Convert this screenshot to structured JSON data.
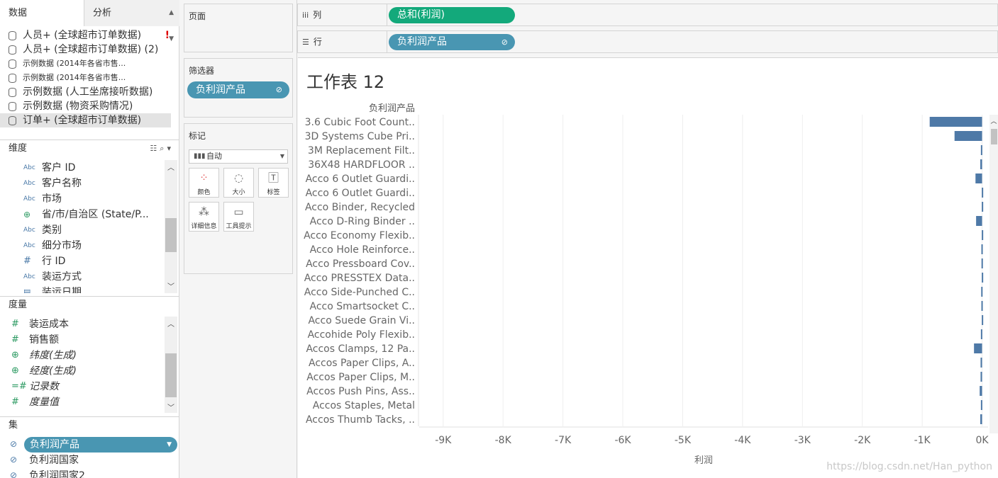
{
  "tabs": {
    "data": "数据",
    "analysis": "分析"
  },
  "datasources": [
    {
      "label": "人员+ (全球超市订单数据)",
      "warn": "!",
      "small": false,
      "selected": false
    },
    {
      "label": "人员+ (全球超市订单数据) (2)",
      "small": false,
      "selected": false
    },
    {
      "label": "示例数据 (2014年各省市售...",
      "small": true,
      "selected": false
    },
    {
      "label": "示例数据 (2014年各省市售...",
      "small": true,
      "selected": false
    },
    {
      "label": "示例数据 (人工坐席接听数据)",
      "small": false,
      "selected": false
    },
    {
      "label": "示例数据 (物资采购情况)",
      "small": false,
      "selected": false
    },
    {
      "label": "订单+ (全球超市订单数据)",
      "small": false,
      "selected": true
    }
  ],
  "dimensions": {
    "header": "维度",
    "items": [
      {
        "icon": "Abc",
        "label": "客户 ID"
      },
      {
        "icon": "Abc",
        "label": "客户名称"
      },
      {
        "icon": "Abc",
        "label": "市场"
      },
      {
        "icon": "globe",
        "label": "省/市/自治区 (State/P..."
      },
      {
        "icon": "Abc",
        "label": "类别"
      },
      {
        "icon": "Abc",
        "label": "细分市场"
      },
      {
        "icon": "#",
        "label": "行 ID"
      },
      {
        "icon": "Abc",
        "label": "装运方式"
      },
      {
        "icon": "date",
        "label": "装运日期"
      }
    ]
  },
  "measures": {
    "header": "度量",
    "items": [
      {
        "icon": "#",
        "label": "装运成本",
        "italic": false
      },
      {
        "icon": "#",
        "label": "销售额",
        "italic": false
      },
      {
        "icon": "globe",
        "label": "纬度(生成)",
        "italic": true
      },
      {
        "icon": "globe",
        "label": "经度(生成)",
        "italic": true
      },
      {
        "icon": "=#",
        "label": "记录数",
        "italic": true
      },
      {
        "icon": "#",
        "label": "度量值",
        "italic": true
      }
    ]
  },
  "sets": {
    "header": "集",
    "items": [
      "负利润产品",
      "负利润国家",
      "负利润国家2"
    ]
  },
  "cards": {
    "pages": "页面",
    "filters": "筛选器",
    "filter_pill": "负利润产品",
    "marks": "标记",
    "mark_type": "自动",
    "mark_buttons": [
      "颜色",
      "大小",
      "标签",
      "详细信息",
      "工具提示"
    ]
  },
  "shelves": {
    "columns_label": "列",
    "columns_pill": "总和(利润)",
    "rows_label": "行",
    "rows_pill": "负利润产品"
  },
  "sheet": {
    "title": "工作表 12"
  },
  "colors": {
    "bar": "#4e79a7",
    "green_pill": "#13a97b",
    "blue_pill": "#4996b2"
  },
  "chart_data": {
    "type": "bar",
    "orientation": "horizontal",
    "row_header": "负利润产品",
    "xlabel": "利润",
    "xlim": [
      -9400,
      100
    ],
    "xticks": [
      "-9K",
      "-8K",
      "-7K",
      "-6K",
      "-5K",
      "-4K",
      "-3K",
      "-2K",
      "-1K",
      "0K"
    ],
    "xtick_values": [
      -9000,
      -8000,
      -7000,
      -6000,
      -5000,
      -4000,
      -3000,
      -2000,
      -1000,
      0
    ],
    "categories": [
      "3.6 Cubic Foot Count..",
      "3D Systems Cube Pri..",
      "3M Replacement Filt..",
      "36X48 HARDFLOOR ..",
      "Acco 6 Outlet Guardi..",
      "Acco 6 Outlet Guardi..",
      "Acco Binder, Recycled",
      "Acco D-Ring Binder ..",
      "Acco Economy Flexib..",
      "Acco Hole Reinforce..",
      "Acco Pressboard Cov..",
      "Acco PRESSTEX Data..",
      "Acco Side-Punched C..",
      "Acco Smartsocket C..",
      "Acco Suede Grain Vi..",
      "Accohide Poly Flexib..",
      "Accos Clamps, 12 Pa..",
      "Accos Paper Clips, A..",
      "Accos Paper Clips, M..",
      "Accos Push Pins, Ass..",
      "Accos Staples, Metal",
      "Accos Thumb Tacks, .."
    ],
    "values": [
      -875,
      -460,
      -20,
      -30,
      -110,
      -5,
      -5,
      -100,
      -5,
      -12,
      -10,
      -5,
      -15,
      -12,
      -5,
      -20,
      -135,
      -25,
      -25,
      -40,
      -20,
      -30
    ]
  },
  "watermark": "https://blog.csdn.net/Han_python"
}
